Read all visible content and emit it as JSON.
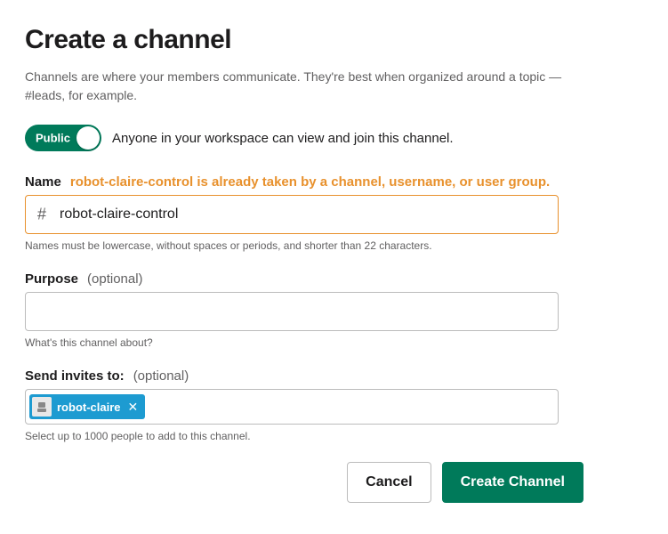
{
  "header": {
    "title": "Create a channel",
    "subtitle": "Channels are where your members communicate. They're best when organized around a topic — #leads, for example."
  },
  "visibility": {
    "toggle_label": "Public",
    "description": "Anyone in your workspace can view and join this channel."
  },
  "name_field": {
    "label": "Name",
    "error": "robot-claire-control is already taken by a channel, username, or user group.",
    "value": "robot-claire-control",
    "hint": "Names must be lowercase, without spaces or periods, and shorter than 22 characters."
  },
  "purpose_field": {
    "label": "Purpose",
    "optional": "(optional)",
    "value": "",
    "hint": "What's this channel about?"
  },
  "invites_field": {
    "label": "Send invites to:",
    "optional": "(optional)",
    "tags": [
      {
        "name": "robot-claire"
      }
    ],
    "hint": "Select up to 1000 people to add to this channel."
  },
  "buttons": {
    "cancel": "Cancel",
    "create": "Create Channel"
  }
}
